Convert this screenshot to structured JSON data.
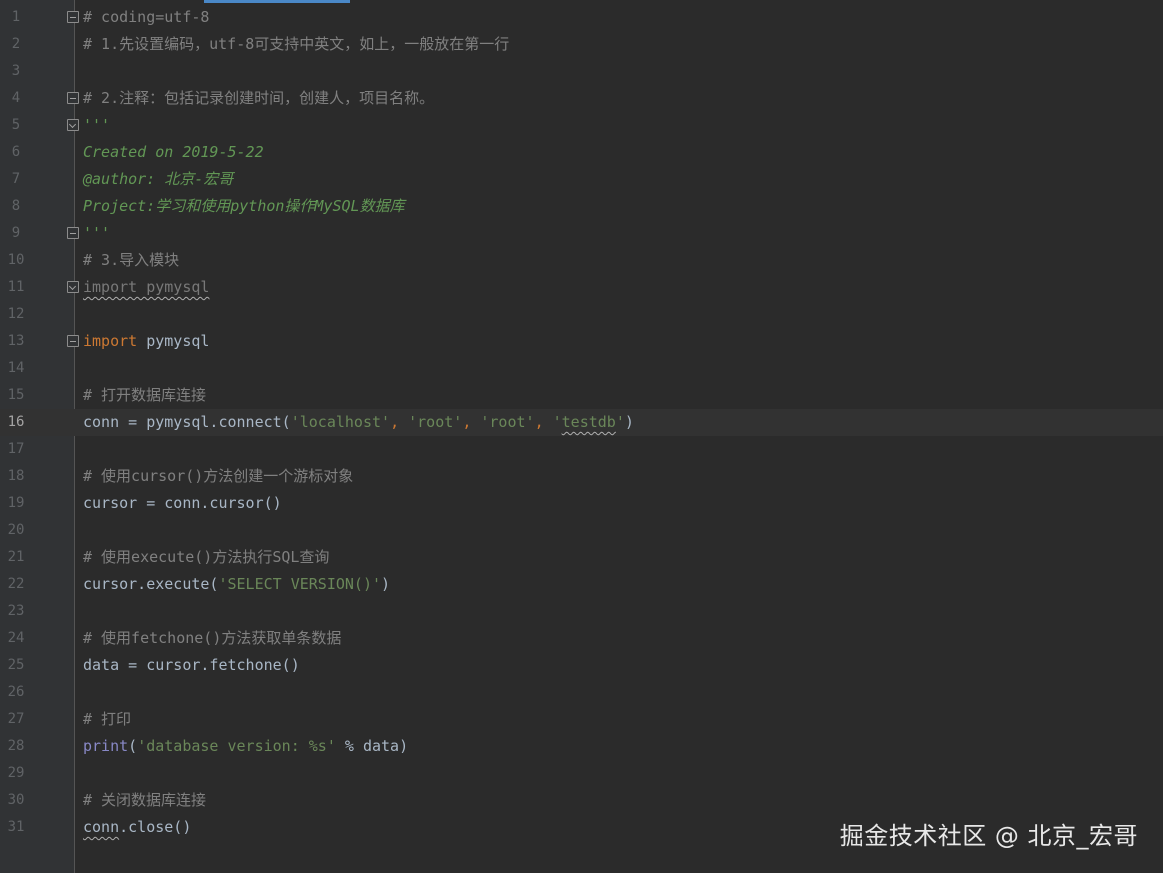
{
  "editor": {
    "current_line": 16,
    "lines": [
      {
        "num": "1",
        "fold": "start",
        "tokens": [
          {
            "t": "# coding=utf-8",
            "c": "comment"
          }
        ]
      },
      {
        "num": "2",
        "tokens": [
          {
            "t": "# 1.先设置编码，utf-8可支持中英文，如上，一般放在第一行",
            "c": "comment"
          }
        ]
      },
      {
        "num": "3",
        "tokens": []
      },
      {
        "num": "4",
        "fold": "start",
        "tokens": [
          {
            "t": "# 2.注释：包括记录创建时间，创建人，项目名称。",
            "c": "comment"
          }
        ]
      },
      {
        "num": "5",
        "fold": "end",
        "tokens": [
          {
            "t": "'''",
            "c": "doc"
          }
        ]
      },
      {
        "num": "6",
        "tokens": [
          {
            "t": "Created on 2019-5-22",
            "c": "doc"
          }
        ]
      },
      {
        "num": "7",
        "tokens": [
          {
            "t": "@author: 北京-宏哥",
            "c": "doc"
          }
        ]
      },
      {
        "num": "8",
        "tokens": [
          {
            "t": "Project:学习和使用python操作MySQL数据库",
            "c": "doc"
          }
        ]
      },
      {
        "num": "9",
        "fold": "start",
        "tokens": [
          {
            "t": "'''",
            "c": "doc"
          }
        ]
      },
      {
        "num": "10",
        "tokens": [
          {
            "t": "# 3.导入模块",
            "c": "comment"
          }
        ]
      },
      {
        "num": "11",
        "fold": "end",
        "tokens": [
          {
            "t": "import pymysql",
            "c": "unused",
            "sq": true
          }
        ]
      },
      {
        "num": "12",
        "tokens": []
      },
      {
        "num": "13",
        "fold": "start",
        "tokens": [
          {
            "t": "import",
            "c": "keyword"
          },
          {
            "t": " pymysql",
            "c": "plain"
          }
        ]
      },
      {
        "num": "14",
        "tokens": []
      },
      {
        "num": "15",
        "tokens": [
          {
            "t": "# 打开数据库连接",
            "c": "comment"
          }
        ]
      },
      {
        "num": "16",
        "tokens": [
          {
            "t": "conn = pymysql.connect(",
            "c": "plain"
          },
          {
            "t": "'localhost'",
            "c": "string"
          },
          {
            "t": ", ",
            "c": "keyword"
          },
          {
            "t": "'root'",
            "c": "string"
          },
          {
            "t": ", ",
            "c": "keyword"
          },
          {
            "t": "'root'",
            "c": "string"
          },
          {
            "t": ", ",
            "c": "keyword"
          },
          {
            "t": "'",
            "c": "string"
          },
          {
            "t": "testdb",
            "c": "string",
            "sq": true
          },
          {
            "t": "'",
            "c": "string"
          },
          {
            "t": ")",
            "c": "plain"
          }
        ]
      },
      {
        "num": "17",
        "tokens": []
      },
      {
        "num": "18",
        "tokens": [
          {
            "t": "# 使用cursor()方法创建一个游标对象",
            "c": "comment"
          }
        ]
      },
      {
        "num": "19",
        "tokens": [
          {
            "t": "cursor = conn.cursor()",
            "c": "plain"
          }
        ]
      },
      {
        "num": "20",
        "tokens": []
      },
      {
        "num": "21",
        "tokens": [
          {
            "t": "# 使用execute()方法执行SQL查询",
            "c": "comment"
          }
        ]
      },
      {
        "num": "22",
        "tokens": [
          {
            "t": "cursor.execute(",
            "c": "plain"
          },
          {
            "t": "'SELECT VERSION()'",
            "c": "string"
          },
          {
            "t": ")",
            "c": "plain"
          }
        ]
      },
      {
        "num": "23",
        "tokens": []
      },
      {
        "num": "24",
        "tokens": [
          {
            "t": "# 使用fetchone()方法获取单条数据",
            "c": "comment"
          }
        ]
      },
      {
        "num": "25",
        "tokens": [
          {
            "t": "data = cursor.fetchone()",
            "c": "plain"
          }
        ]
      },
      {
        "num": "26",
        "tokens": []
      },
      {
        "num": "27",
        "tokens": [
          {
            "t": "# 打印",
            "c": "comment"
          }
        ]
      },
      {
        "num": "28",
        "tokens": [
          {
            "t": "print",
            "c": "builtin"
          },
          {
            "t": "(",
            "c": "plain"
          },
          {
            "t": "'database version: %s'",
            "c": "string"
          },
          {
            "t": " % data)",
            "c": "plain"
          }
        ]
      },
      {
        "num": "29",
        "tokens": []
      },
      {
        "num": "30",
        "tokens": [
          {
            "t": "# 关闭数据库连接",
            "c": "comment"
          }
        ]
      },
      {
        "num": "31",
        "tokens": [
          {
            "t": "conn",
            "c": "plain",
            "sq": true
          },
          {
            "t": ".close()",
            "c": "plain"
          }
        ]
      }
    ]
  },
  "watermark": "掘金技术社区 @ 北京_宏哥"
}
